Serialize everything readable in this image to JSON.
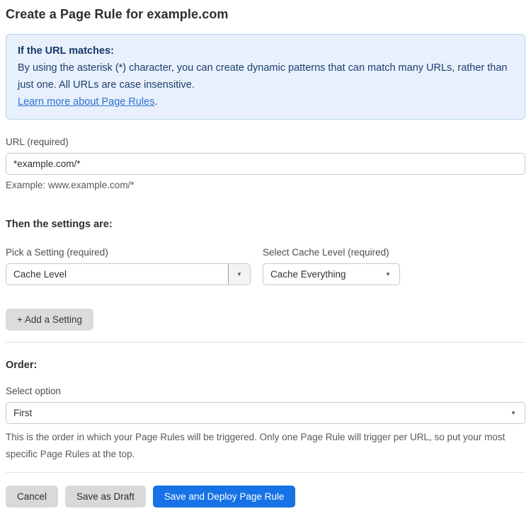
{
  "page": {
    "title": "Create a Page Rule for example.com"
  },
  "info_box": {
    "heading": "If the URL matches:",
    "body": "By using the asterisk (*) character, you can create dynamic patterns that can match many URLs, rather than just one. All URLs are case insensitive.",
    "link_label": "Learn more about Page Rules",
    "link_suffix": "."
  },
  "url_field": {
    "label": "URL (required)",
    "value": "*example.com/*",
    "helper": "Example: www.example.com/*"
  },
  "settings": {
    "heading": "Then the settings are:",
    "setting_picker": {
      "label": "Pick a Setting (required)",
      "value": "Cache Level"
    },
    "cache_level_picker": {
      "label": "Select Cache Level (required)",
      "value": "Cache Everything"
    },
    "add_setting_label": "+ Add a Setting"
  },
  "order": {
    "heading": "Order:",
    "label": "Select option",
    "value": "First",
    "helper": "This is the order in which your Page Rules will be triggered. Only one Page Rule will trigger per URL, so put your most specific Page Rules at the top."
  },
  "footer": {
    "cancel_label": "Cancel",
    "save_draft_label": "Save as Draft",
    "save_deploy_label": "Save and Deploy Page Rule"
  },
  "icons": {
    "dropdown_arrow": "▼"
  },
  "colors": {
    "accent_blue": "#1672e6",
    "info_bg": "#e8f1fb",
    "info_border": "#b5d3f0",
    "info_text": "#1d3d6f",
    "link_blue": "#2f6fd6"
  }
}
